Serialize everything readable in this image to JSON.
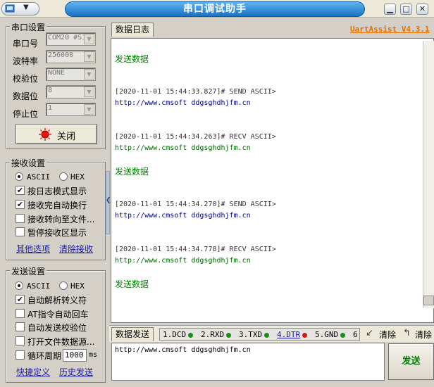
{
  "window": {
    "title": "串口调试助手"
  },
  "port_settings": {
    "title": "串口设置",
    "port_label": "串口号",
    "port_value": "COM20 #S1",
    "baud_label": "波特率",
    "baud_value": "256000",
    "parity_label": "校验位",
    "parity_value": "NONE",
    "databits_label": "数据位",
    "databits_value": "8",
    "stopbits_label": "停止位",
    "stopbits_value": "1",
    "close_button": "关闭"
  },
  "receive_settings": {
    "title": "接收设置",
    "ascii": "ASCII",
    "hex": "HEX",
    "log_mode": "按日志模式显示",
    "auto_newline": "接收完自动换行",
    "to_file": "接收转向至文件...",
    "pause": "暂停接收区显示",
    "more_options": "其他选项",
    "clear_receive": "清除接收"
  },
  "send_settings": {
    "title": "发送设置",
    "ascii": "ASCII",
    "hex": "HEX",
    "auto_escape": "自动解析转义符",
    "at_auto_cr": "AT指令自动回车",
    "auto_checksum": "自动发送校验位",
    "open_file": "打开文件数据源...",
    "loop_period": "循环周期",
    "loop_value": "1000",
    "loop_unit": "ms",
    "shortcuts": "快捷定义",
    "history": "历史发送"
  },
  "log_tab": {
    "label": "数据日志",
    "brand": "UartAssist V4.3.1"
  },
  "log": {
    "sent_1": "发送数据",
    "stamp_1": "[2020-11-01 15:44:33.827]# SEND ASCII>",
    "url_1": "http://www.cmsoft ddgsghdhjfm.cn",
    "stamp_2": "[2020-11-01 15:44:34.263]# RECV ASCII>",
    "url_2": "http://www.cmsoft ddgsghdhjfm.cn",
    "sent_2": "发送数据",
    "stamp_3": "[2020-11-01 15:44:34.270]# SEND ASCII>",
    "url_3": "http://www.cmsoft ddgsghdhjfm.cn",
    "stamp_4": "[2020-11-01 15:44:34.778]# RECV ASCII>",
    "url_4": "http://www.cmsoft ddgsghdhjfm.cn",
    "sent_3": "发送数据"
  },
  "send_bar": {
    "tab": "数据发送",
    "pins": [
      "1.DCD",
      "2.RXD",
      "3.TXD",
      "4.DTR",
      "5.GND",
      "6"
    ],
    "clear_label": "清除",
    "clear_all_label": "清除"
  },
  "send_area": {
    "text": "http://www.cmsoft ddgsghdhjfm.cn",
    "send_button": "发送"
  },
  "colors": {
    "title_blue": "#1a72c6",
    "sent_green": "#008000",
    "brand_orange": "#e07000",
    "led_green": "#1c8a1c",
    "led_red": "#d01818"
  }
}
